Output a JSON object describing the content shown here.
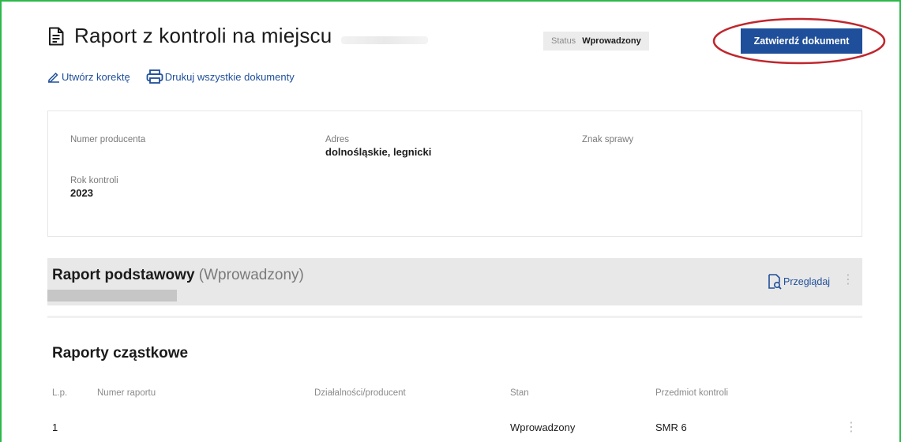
{
  "header": {
    "title": "Raport z kontroli na miejscu",
    "status_label": "Status",
    "status_value": "Wprowadzony",
    "approve_button": "Zatwierdź dokument"
  },
  "actions": {
    "create_correction": "Utwórz korektę",
    "print_all": "Drukuj wszystkie dokumenty"
  },
  "info": {
    "producer_number_label": "Numer producenta",
    "producer_number_value": "",
    "address_label": "Adres",
    "address_value": "dolnośląskie, legnicki",
    "case_mark_label": "Znak sprawy",
    "case_mark_value": "",
    "year_label": "Rok kontroli",
    "year_value": "2023"
  },
  "basic_report": {
    "title": "Raport podstawowy",
    "status": "(Wprowadzony)",
    "browse_label": "Przeglądaj"
  },
  "partial_reports": {
    "title": "Raporty cząstkowe",
    "columns": [
      "L.p.",
      "Numer raportu",
      "Działalności/producent",
      "Stan",
      "Przedmiot kontroli"
    ],
    "rows": [
      {
        "lp": "1",
        "report_number": "",
        "producer": "",
        "state": "Wprowadzony",
        "subject": "SMR 6"
      }
    ]
  },
  "colors": {
    "accent": "#1f4f9a",
    "frame_border": "#2db84a",
    "annotation_ellipse": "#c0262d"
  },
  "icons": {
    "title": "document-icon",
    "correction": "pencil-icon",
    "print": "printer-icon",
    "browse": "document-search-icon",
    "row_menu": "kebab-menu-icon"
  }
}
